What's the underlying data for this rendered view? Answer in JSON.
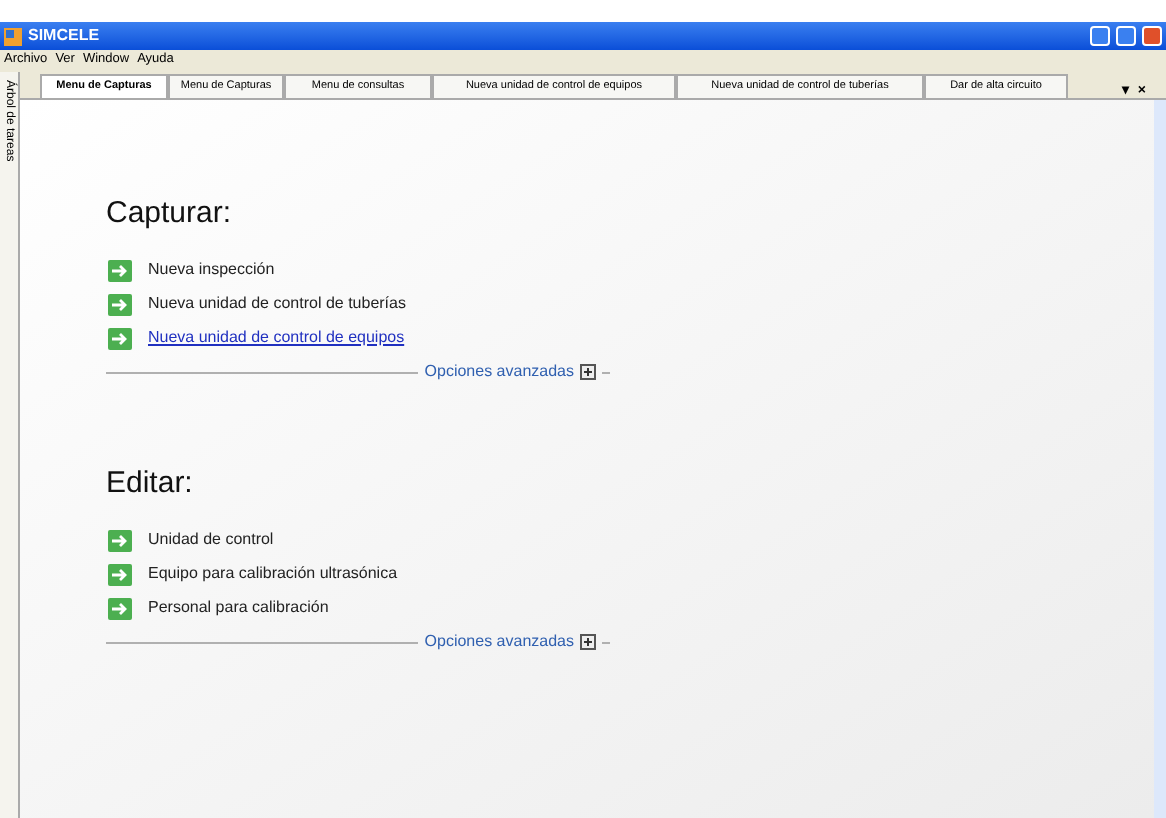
{
  "window": {
    "title": "SIMCELE"
  },
  "menu": [
    "Archivo",
    "Ver",
    "Window",
    "Ayuda"
  ],
  "side_tab": {
    "label": "Árbol de tareas"
  },
  "tabs": [
    {
      "label": "Menu de Capturas",
      "selected": true
    },
    {
      "label": "Menu  de Capturas",
      "selected": false
    },
    {
      "label": "Menu de consultas",
      "selected": false
    },
    {
      "label": "Nueva unidad de control de equipos",
      "selected": false
    },
    {
      "label": "Nueva unidad de control de tuberías",
      "selected": false
    },
    {
      "label": "Dar de alta circuito",
      "selected": false
    }
  ],
  "tab_controls": [
    "▾",
    "×"
  ],
  "sections": [
    {
      "title": "Capturar:",
      "items": [
        {
          "label": "Nueva inspección",
          "highlighted": false
        },
        {
          "label": "Nueva unidad de control de tuberías",
          "highlighted": false
        },
        {
          "label": "Nueva unidad de control de equipos",
          "highlighted": true
        }
      ],
      "advanced": "Opciones avanzadas"
    },
    {
      "title": "Editar:",
      "items": [
        {
          "label": "Unidad de control",
          "highlighted": false
        },
        {
          "label": "Equipo para calibración ultrasónica",
          "highlighted": false
        },
        {
          "label": "Personal para calibración",
          "highlighted": false
        }
      ],
      "advanced": "Opciones avanzadas"
    }
  ]
}
